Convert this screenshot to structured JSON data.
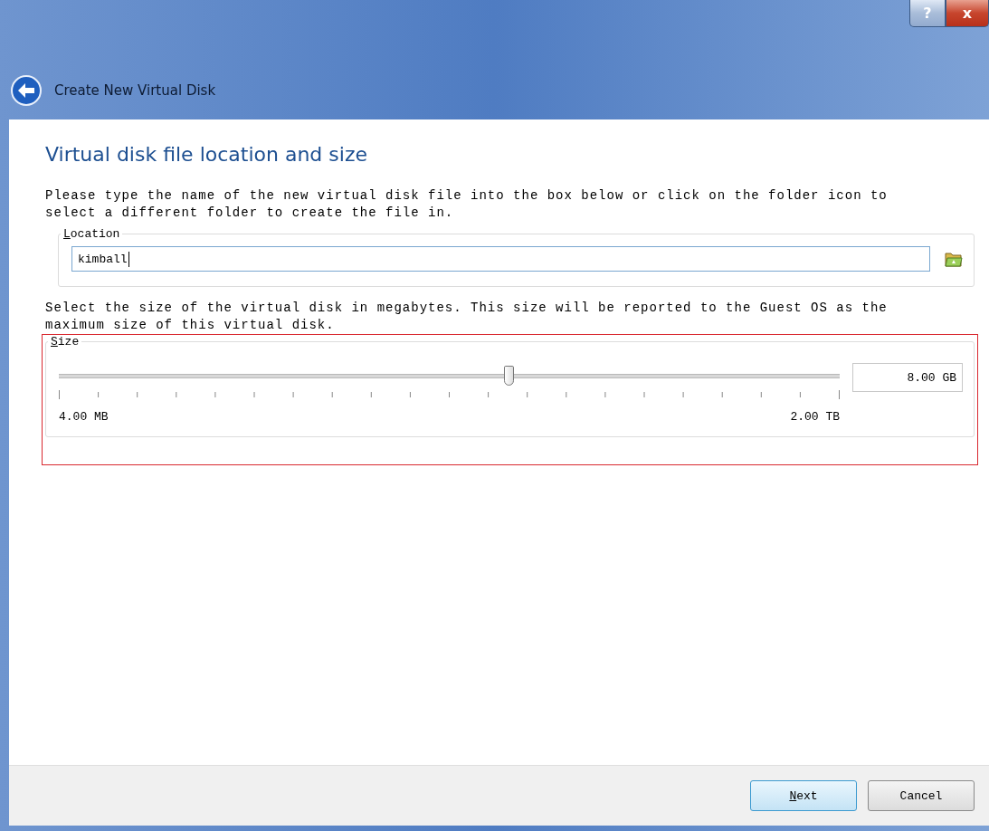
{
  "window": {
    "title": "Create New Virtual Disk"
  },
  "title_buttons": [
    {
      "kind": "help",
      "label": "?"
    },
    {
      "kind": "close",
      "label": "x"
    }
  ],
  "page": {
    "heading": "Virtual disk file location and size",
    "location_intro": "Please type the name of the new virtual disk file into the box below or click on the folder icon to select a different folder to create the file in.",
    "location": {
      "legend": "Location",
      "value": "kimball"
    },
    "size_intro": "Select the size of the virtual disk in megabytes. This size will be reported to the Guest OS as the maximum size of this virtual disk.",
    "size": {
      "legend": "Size",
      "level": 0.577,
      "value": "8.00 GB",
      "min_label": "4.00 MB",
      "max_label": "2.00 TB"
    }
  },
  "buttons": [
    {
      "label": "Next",
      "default": true,
      "mnemonic": true
    },
    {
      "label": "Cancel",
      "default": false,
      "mnemonic": false
    }
  ]
}
